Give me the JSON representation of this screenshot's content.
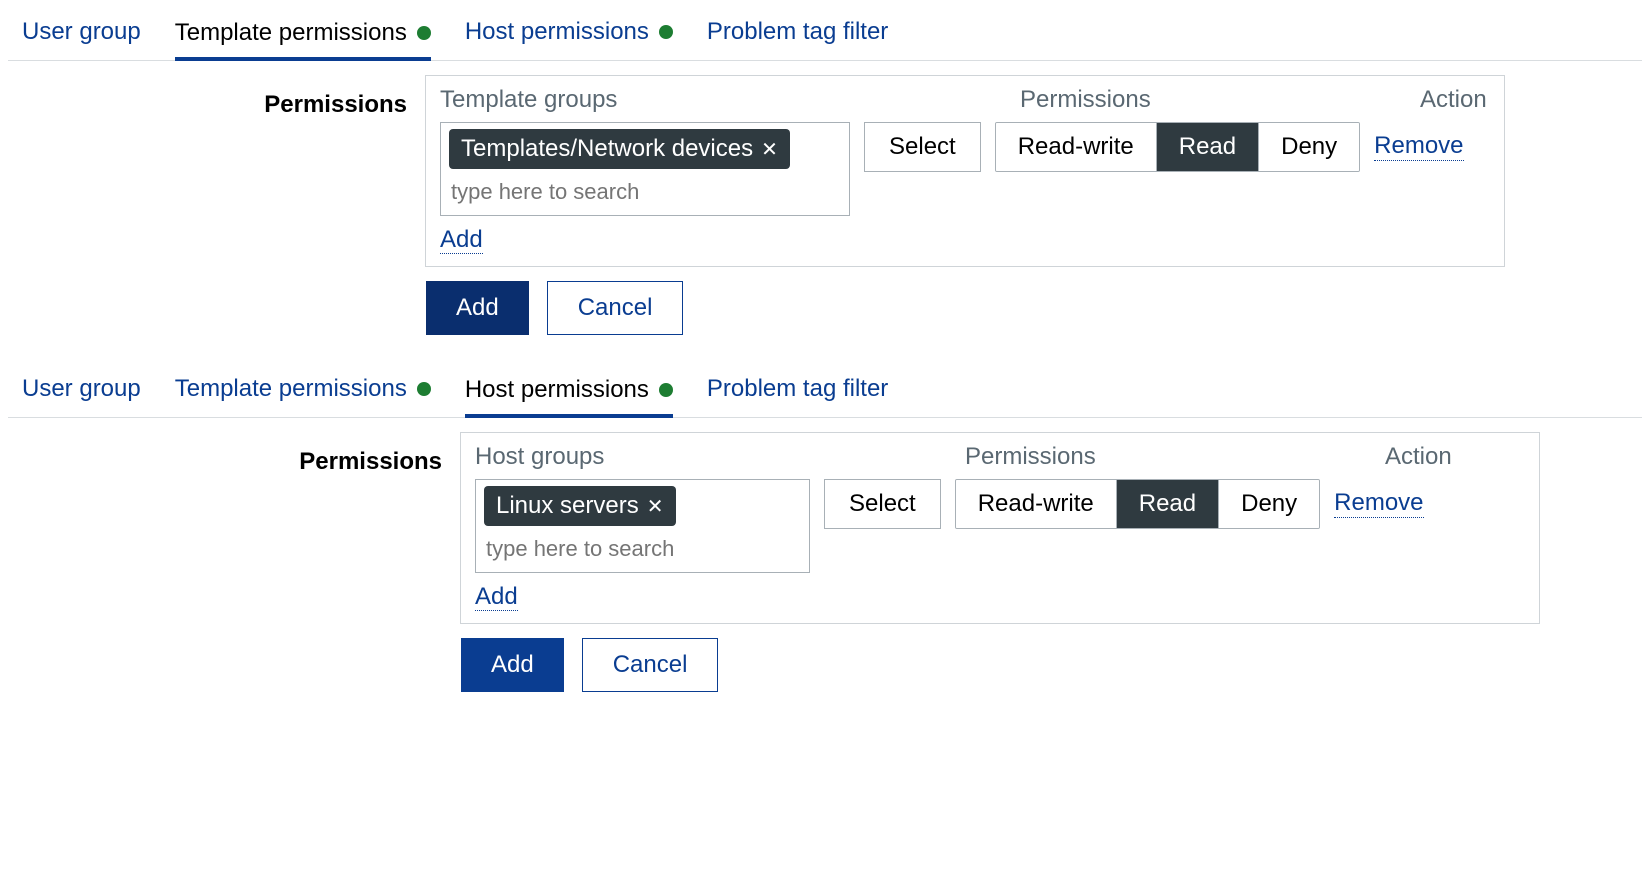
{
  "tabs": [
    "User group",
    "Template permissions",
    "Host permissions",
    "Problem tag filter"
  ],
  "labels": {
    "permissions": "Permissions",
    "action": "Action",
    "select": "Select",
    "remove": "Remove",
    "add_link": "Add",
    "add_btn": "Add",
    "cancel": "Cancel",
    "search_placeholder": "type here to search"
  },
  "perm_options": [
    "Read-write",
    "Read",
    "Deny"
  ],
  "sections": [
    {
      "active_tab": 1,
      "groups_title": "Template groups",
      "tag": "Templates/Network devices",
      "perm_selected": 1
    },
    {
      "active_tab": 2,
      "groups_title": "Host groups",
      "tag": "Linux servers",
      "perm_selected": 1
    }
  ]
}
